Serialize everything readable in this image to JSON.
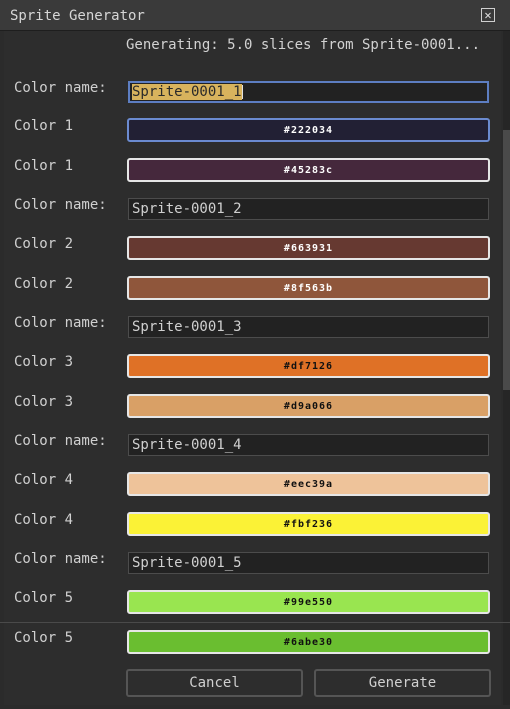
{
  "window": {
    "title": "Sprite Generator"
  },
  "subtitle": "Generating: 5.0 slices from Sprite-0001...",
  "rows": [
    {
      "kind": "name",
      "label": "Color name:",
      "value": "Sprite-0001_1",
      "active": true
    },
    {
      "kind": "color",
      "label": "Color 1",
      "hex": "#222034",
      "text_color": "#ffffff",
      "focused": true
    },
    {
      "kind": "color",
      "label": "Color 1",
      "hex": "#45283c",
      "text_color": "#ffffff"
    },
    {
      "kind": "name",
      "label": "Color name:",
      "value": "Sprite-0001_2"
    },
    {
      "kind": "color",
      "label": "Color 2",
      "hex": "#663931",
      "text_color": "#ffffff"
    },
    {
      "kind": "color",
      "label": "Color 2",
      "hex": "#8f563b",
      "text_color": "#ffffff"
    },
    {
      "kind": "name",
      "label": "Color name:",
      "value": "Sprite-0001_3"
    },
    {
      "kind": "color",
      "label": "Color 3",
      "hex": "#df7126",
      "text_color": "#111111"
    },
    {
      "kind": "color",
      "label": "Color 3",
      "hex": "#d9a066",
      "text_color": "#111111"
    },
    {
      "kind": "name",
      "label": "Color name:",
      "value": "Sprite-0001_4"
    },
    {
      "kind": "color",
      "label": "Color 4",
      "hex": "#eec39a",
      "text_color": "#111111"
    },
    {
      "kind": "color",
      "label": "Color 4",
      "hex": "#fbf236",
      "text_color": "#111111"
    },
    {
      "kind": "name",
      "label": "Color name:",
      "value": "Sprite-0001_5"
    },
    {
      "kind": "color",
      "label": "Color 5",
      "hex": "#99e550",
      "text_color": "#111111"
    },
    {
      "kind": "color",
      "label": "Color 5",
      "hex": "#6abe30",
      "text_color": "#111111"
    }
  ],
  "buttons": {
    "cancel": "Cancel",
    "generate": "Generate"
  },
  "icons": {
    "close": "close-icon"
  }
}
